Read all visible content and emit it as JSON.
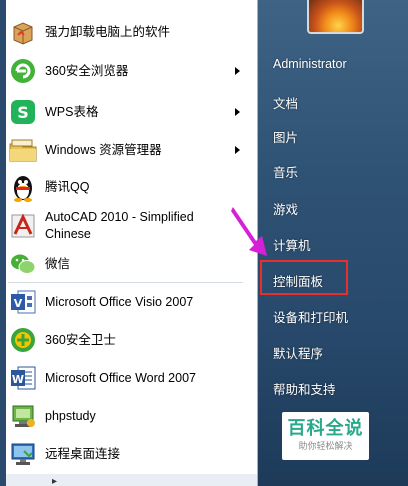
{
  "left_panel": {
    "items": [
      {
        "label_lines": [
          "强力卸载电脑上的软件"
        ],
        "icon": "uninstall-box-icon",
        "has_arrow": false
      },
      {
        "label_lines": [
          "360安全浏览器"
        ],
        "icon": "360-browser-icon",
        "has_arrow": true
      },
      {
        "label_lines": [
          "WPS表格"
        ],
        "icon": "wps-spreadsheet-icon",
        "has_arrow": true
      },
      {
        "label_lines": [
          "Windows 资源管理器"
        ],
        "icon": "folder-explorer-icon",
        "has_arrow": true
      },
      {
        "label_lines": [
          "腾讯QQ"
        ],
        "icon": "qq-penguin-icon",
        "has_arrow": false
      },
      {
        "label_lines": [
          "AutoCAD 2010 - Simplified",
          "Chinese"
        ],
        "icon": "autocad-icon",
        "has_arrow": false
      },
      {
        "label_lines": [
          "微信"
        ],
        "icon": "wechat-icon",
        "has_arrow": false
      },
      {
        "label_lines": [
          "Microsoft Office Visio 2007"
        ],
        "icon": "visio-icon",
        "has_arrow": false
      },
      {
        "label_lines": [
          "360安全卫士"
        ],
        "icon": "360-safeguard-icon",
        "has_arrow": false
      },
      {
        "label_lines": [
          "Microsoft Office Word 2007"
        ],
        "icon": "word-icon",
        "has_arrow": false
      },
      {
        "label_lines": [
          "phpstudy"
        ],
        "icon": "phpstudy-icon",
        "has_arrow": false
      },
      {
        "label_lines": [
          "远程桌面连接"
        ],
        "icon": "remote-desktop-icon",
        "has_arrow": false
      }
    ]
  },
  "right_panel": {
    "items": [
      "Administrator",
      "文档",
      "图片",
      "音乐",
      "游戏",
      "计算机",
      "控制面板",
      "设备和打印机",
      "默认程序",
      "帮助和支持"
    ],
    "highlighted": "控制面板"
  },
  "watermark": {
    "title": "百科全说",
    "subtitle": "助你轻松解决"
  },
  "colors": {
    "highlight": "#e8302a",
    "arrow": "#d81fd8",
    "watermark": "#2aa88a"
  }
}
